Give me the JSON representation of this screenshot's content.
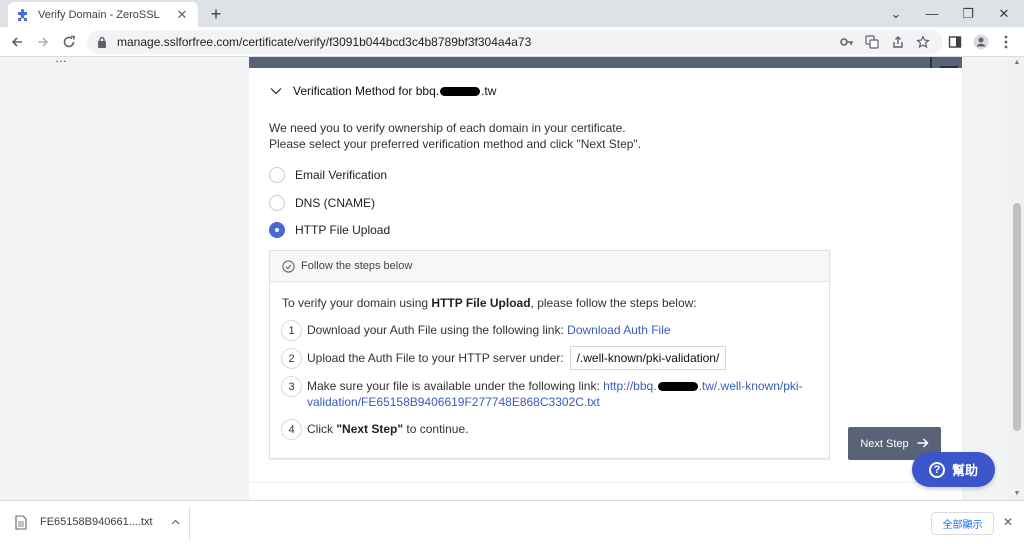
{
  "browser": {
    "tab_title": "Verify Domain - ZeroSSL",
    "tab_close": "✕",
    "new_tab": "+",
    "url": "manage.sslforfree.com/certificate/verify/f3091b044bcd3c4b8789bf3f304a4a73",
    "win_min": "⌄",
    "win_minimize": "—",
    "win_restore": "❐",
    "win_close": "✕"
  },
  "left_fragment": "…",
  "section": {
    "title_prefix": "Verification Method for bbq.",
    "title_suffix": ".tw",
    "intro_line1": "We need you to verify ownership of each domain in your certificate.",
    "intro_line2": "Please select your preferred verification method and click \"Next Step\"."
  },
  "methods": [
    {
      "label": "Email Verification",
      "checked": false
    },
    {
      "label": "DNS (CNAME)",
      "checked": false
    },
    {
      "label": "HTTP File Upload",
      "checked": true
    }
  ],
  "steps": {
    "header": "Follow the steps below",
    "intro_pre": "To verify your domain using ",
    "intro_bold": "HTTP File Upload",
    "intro_post": ", please follow the steps below:",
    "items": [
      {
        "num": "1",
        "text": "Download your Auth File using the following link: ",
        "link": "Download Auth File"
      },
      {
        "num": "2",
        "text": "Upload the Auth File to your HTTP server under:",
        "path": "/.well-known/pki-validation/"
      },
      {
        "num": "3",
        "text": "Make sure your file is available under the following link: ",
        "link_pre": "http://bbq.",
        "link_mid": ".tw/.well-known/pki-",
        "link_line2": "validation/FE65158B9406619F277748E868C3302C.txt"
      },
      {
        "num": "4",
        "text_pre": "Click ",
        "bold": "\"Next Step\"",
        "text_post": " to continue."
      }
    ]
  },
  "next_button": "Next Step",
  "help_button": "幫助",
  "download": {
    "file_name": "FE65158B940661....txt",
    "show_all": "全部顯示",
    "close": "✕"
  },
  "colors": {
    "accent": "#4a67d6",
    "button": "#5a6275",
    "help": "#3a56c9",
    "link": "#3a5bbf"
  }
}
